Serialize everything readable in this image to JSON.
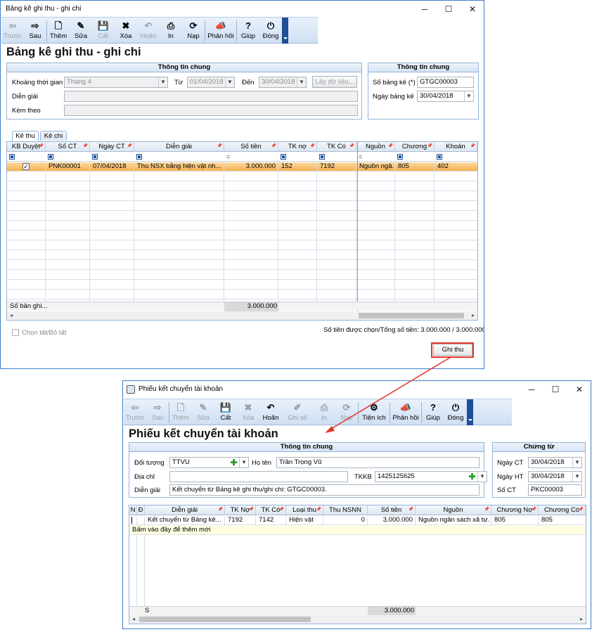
{
  "w1": {
    "title": "Bảng kê ghi thu - ghi chi",
    "toolbar": [
      {
        "label": "Trước",
        "glyph": "⇦",
        "disabled": true
      },
      {
        "label": "Sau",
        "glyph": "⇨",
        "disabled": false
      },
      {
        "label": "Thêm",
        "glyph": "🗋",
        "disabled": false
      },
      {
        "label": "Sửa",
        "glyph": "✎",
        "disabled": false
      },
      {
        "label": "Cất",
        "glyph": "💾",
        "disabled": true
      },
      {
        "label": "Xóa",
        "glyph": "✖",
        "disabled": false
      },
      {
        "label": "Hoãn",
        "glyph": "↶",
        "disabled": true
      },
      {
        "label": "In",
        "glyph": "⎙",
        "disabled": false
      },
      {
        "label": "Nạp",
        "glyph": "⟳",
        "disabled": false
      },
      {
        "label": "Phản hồi",
        "glyph": "📣",
        "disabled": false
      },
      {
        "label": "Giúp",
        "glyph": "?",
        "disabled": false
      },
      {
        "label": "Đóng",
        "glyph": "⏻",
        "disabled": false
      }
    ],
    "heading": "Bảng kê ghi thu - ghi chi",
    "info_title": "Thông tin chung",
    "khoang_label": "Khoảng thời gian",
    "khoang_value": "Tháng 4",
    "tu_label": "Từ",
    "tu_value": "01/04/2018",
    "den_label": "Đến",
    "den_value": "30/04/2018",
    "lay_btn": "Lấy dữ liệu...",
    "dien_giai_label": "Diễn giải",
    "dien_giai_value": "",
    "kem_theo_label": "Kèm theo",
    "kem_theo_value": "",
    "info2_title": "Thông tin chung",
    "so_bang_ke_label": "Số bảng kê (*)",
    "so_bang_ke_value": "GTGC00003",
    "ngay_bang_ke_label": "Ngày bảng kê",
    "ngay_bang_ke_value": "30/04/2018",
    "tabs": [
      "Kê thu",
      "Kê chi"
    ],
    "columns": [
      "KB Duyệt",
      "Số CT",
      "Ngày CT",
      "Diễn giải",
      "Số tiền",
      "TK nợ",
      "TK Có",
      "Nguồn",
      "Chương",
      "Khoản"
    ],
    "row": {
      "checked": true,
      "so_ct": "PNK00001",
      "ngay_ct": "07/04/2018",
      "dien_giai": "Thu NSX bằng hiện vật nh...",
      "so_tien": "3.000.000",
      "tk_no": "152",
      "tk_co": "7192",
      "nguon": "Nguồn ngâ...",
      "chuong": "805",
      "khoan": "402"
    },
    "footer_label": "Số bản ghi...",
    "footer_total": "3.000.000",
    "chon_tat": "Chọn tất/Bỏ tất",
    "summary": "Số tiền được chọn/Tổng số tiền: 3.000.000  / 3.000.000",
    "ghi_thu_btn": "Ghi thu"
  },
  "w2": {
    "title": "Phiếu kết chuyển tài khoản",
    "toolbar": [
      {
        "label": "Trước",
        "glyph": "⇦",
        "disabled": true
      },
      {
        "label": "Sau",
        "glyph": "⇨",
        "disabled": true
      },
      {
        "label": "Thêm",
        "glyph": "🗋",
        "disabled": true
      },
      {
        "label": "Sửa",
        "glyph": "✎",
        "disabled": true
      },
      {
        "label": "Cất",
        "glyph": "💾",
        "disabled": false
      },
      {
        "label": "Xóa",
        "glyph": "✖",
        "disabled": true
      },
      {
        "label": "Hoãn",
        "glyph": "↶",
        "disabled": false
      },
      {
        "label": "Ghi sổ",
        "glyph": "✐",
        "disabled": true
      },
      {
        "label": "In",
        "glyph": "⎙",
        "disabled": true
      },
      {
        "label": "Nạp",
        "glyph": "⟳",
        "disabled": true
      },
      {
        "label": "Tiện ích",
        "glyph": "⚙",
        "disabled": false
      },
      {
        "label": "Phản hồi",
        "glyph": "📣",
        "disabled": false
      },
      {
        "label": "Giúp",
        "glyph": "?",
        "disabled": false
      },
      {
        "label": "Đóng",
        "glyph": "⏻",
        "disabled": false
      }
    ],
    "heading": "Phiếu kết chuyển tài khoản",
    "info_title": "Thông tin chung",
    "doi_tuong_label": "Đối tượng",
    "doi_tuong_value": "TTVU",
    "ho_ten_label": "Họ tên",
    "ho_ten_value": "Trần Trọng Vũ",
    "dia_chi_label": "Địa chỉ",
    "dia_chi_value": "",
    "tkkb_label": "TKKB",
    "tkkb_value": "1425125625",
    "dien_giai_label": "Diễn giải",
    "dien_giai_value": "Kết chuyển từ Bảng kê ghi thu/ghi chi: GTGC00003.",
    "chung_tu_title": "Chứng từ",
    "ngay_ct_label": "Ngày CT",
    "ngay_ct_value": "30/04/2018",
    "ngay_ht_label": "Ngày HT",
    "ngay_ht_value": "30/04/2018",
    "so_ct_label": "Số CT",
    "so_ct_value": "PKC00003",
    "columns": [
      "N",
      "Đ",
      "Diễn giải",
      "TK Nợ",
      "TK Có",
      "Loại thu",
      "Thu NSNN",
      "Số tiền",
      "Nguồn",
      "Chương Nợ",
      "Chương Có"
    ],
    "row": {
      "dien_giai": "Kết chuyển từ Bảng kê...",
      "tk_no": "7192",
      "tk_co": "7142",
      "loai_thu": "Hiện vật",
      "thu_nsnn": "0",
      "so_tien": "3.000.000",
      "nguon": "Nguồn ngân sách xã tự...",
      "chuong_no": "805",
      "chuong_co": "805"
    },
    "add_row": "Bấm vào đây để thêm mới",
    "footer_s": "S",
    "footer_total": "3.000.000"
  },
  "colors": {
    "accent": "#1d4f9a",
    "highlight": "#e0362a",
    "selected_row": "#f5b14d",
    "new_row": "#ffffe0"
  }
}
